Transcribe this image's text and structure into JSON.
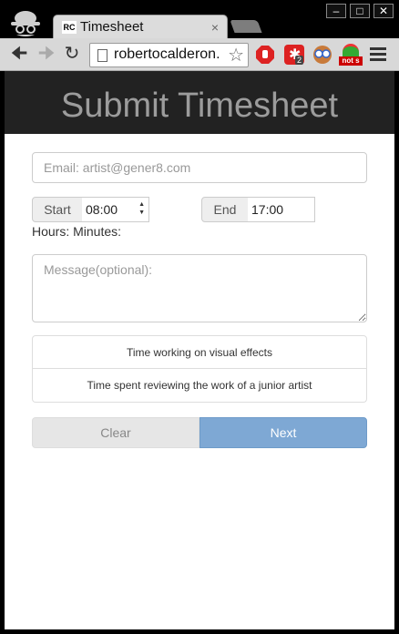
{
  "browser": {
    "tab_title": "Timesheet",
    "tab_favicon": "RC",
    "tab_close": "×",
    "url": "robertocalderon.",
    "extension_badge": "2",
    "notes_badge": "not s",
    "window_controls": [
      "–",
      "□",
      "✕"
    ],
    "icons": [
      "incognito-icon",
      "back-icon",
      "forward-icon",
      "reload-icon",
      "page-icon",
      "star-icon",
      "adblock-icon",
      "extension-icon",
      "eyes-icon",
      "notes-icon",
      "menu-icon"
    ]
  },
  "page": {
    "title": "Submit Timesheet",
    "email_placeholder": "Email: artist@gener8.com",
    "start_label": "Start",
    "start_value": "08:00",
    "end_label": "End",
    "end_value": "17:00",
    "hours_minutes_label": "Hours: Minutes:",
    "message_placeholder": "Message(optional):",
    "tasks": [
      "Time working on visual effects",
      "Time spent reviewing the work of a junior artist"
    ],
    "clear_label": "Clear",
    "next_label": "Next"
  },
  "colors": {
    "header_bg": "#222222",
    "title": "#9c9c9c",
    "next_bg": "#7ea8d4",
    "clear_bg": "#e6e6e6"
  }
}
